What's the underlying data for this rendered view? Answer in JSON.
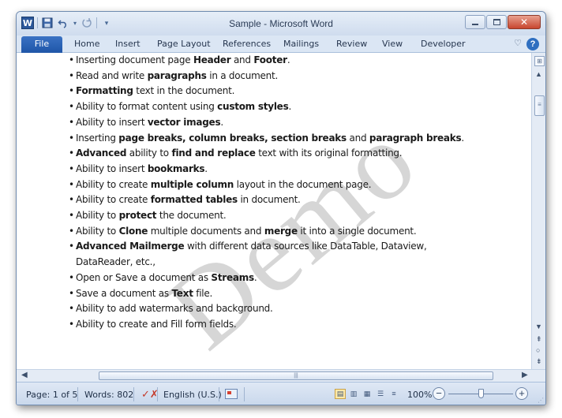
{
  "window": {
    "title": "Sample - Microsoft Word",
    "word_icon_letter": "W"
  },
  "quick_access": {
    "icons": [
      "save-icon",
      "undo-icon",
      "redo-icon",
      "customize-icon"
    ]
  },
  "ribbon": {
    "file_label": "File",
    "tabs": [
      "Home",
      "Insert",
      "Page Layout",
      "References",
      "Mailings",
      "Review",
      "View",
      "Developer"
    ],
    "help_label": "?"
  },
  "watermark": {
    "text": "Demo"
  },
  "document": {
    "items": [
      [
        {
          "t": "Inserting document page ",
          "b": false
        },
        {
          "t": "Header",
          "b": true
        },
        {
          "t": " and ",
          "b": false
        },
        {
          "t": "Footer",
          "b": true
        },
        {
          "t": ".",
          "b": false
        }
      ],
      [
        {
          "t": "Read and write ",
          "b": false
        },
        {
          "t": "paragraphs",
          "b": true
        },
        {
          "t": " in a document.",
          "b": false
        }
      ],
      [
        {
          "t": "Formatting",
          "b": true
        },
        {
          "t": " text in the document.",
          "b": false
        }
      ],
      [
        {
          "t": "Ability to format content using ",
          "b": false
        },
        {
          "t": "custom styles",
          "b": true
        },
        {
          "t": ".",
          "b": false
        }
      ],
      [
        {
          "t": "Ability to insert ",
          "b": false
        },
        {
          "t": "vector images",
          "b": true
        },
        {
          "t": ".",
          "b": false
        }
      ],
      [
        {
          "t": "Inserting ",
          "b": false
        },
        {
          "t": "page breaks, column breaks, section breaks",
          "b": true
        },
        {
          "t": " and ",
          "b": false
        },
        {
          "t": "paragraph breaks",
          "b": true
        },
        {
          "t": ".",
          "b": false
        }
      ],
      [
        {
          "t": "Advanced",
          "b": true
        },
        {
          "t": " ability to ",
          "b": false
        },
        {
          "t": "find and replace",
          "b": true
        },
        {
          "t": " text with its original formatting.",
          "b": false
        }
      ],
      [
        {
          "t": "Ability to insert ",
          "b": false
        },
        {
          "t": "bookmarks",
          "b": true
        },
        {
          "t": ".",
          "b": false
        }
      ],
      [
        {
          "t": "Ability to create ",
          "b": false
        },
        {
          "t": "multiple column",
          "b": true
        },
        {
          "t": " layout in the document page.",
          "b": false
        }
      ],
      [
        {
          "t": "Ability to create ",
          "b": false
        },
        {
          "t": "formatted tables",
          "b": true
        },
        {
          "t": " in document.",
          "b": false
        }
      ],
      [
        {
          "t": "Ability to ",
          "b": false
        },
        {
          "t": "protect",
          "b": true
        },
        {
          "t": " the document.",
          "b": false
        }
      ],
      [
        {
          "t": "Ability to ",
          "b": false
        },
        {
          "t": "Clone",
          "b": true
        },
        {
          "t": " multiple documents and ",
          "b": false
        },
        {
          "t": "merge",
          "b": true
        },
        {
          "t": " it into a single document.",
          "b": false
        }
      ],
      [
        {
          "t": "Advanced Mailmerge",
          "b": true
        },
        {
          "t": " with different data sources like DataTable, Dataview, DataReader, etc.,",
          "b": false
        }
      ],
      [
        {
          "t": "Open or Save a document as ",
          "b": false
        },
        {
          "t": "Streams",
          "b": true
        },
        {
          "t": ".",
          "b": false
        }
      ],
      [
        {
          "t": "Save a document as ",
          "b": false
        },
        {
          "t": "Text",
          "b": true
        },
        {
          "t": " file.",
          "b": false
        }
      ],
      [
        {
          "t": "Ability to add watermarks and background.",
          "b": false
        }
      ],
      [
        {
          "t": "Ability to create and Fill form fields.",
          "b": false
        }
      ]
    ]
  },
  "statusbar": {
    "page": "Page: 1 of 5",
    "words": "Words: 802",
    "language": "English (U.S.)",
    "zoom": "100%",
    "zoom_out": "−",
    "zoom_in": "+"
  }
}
